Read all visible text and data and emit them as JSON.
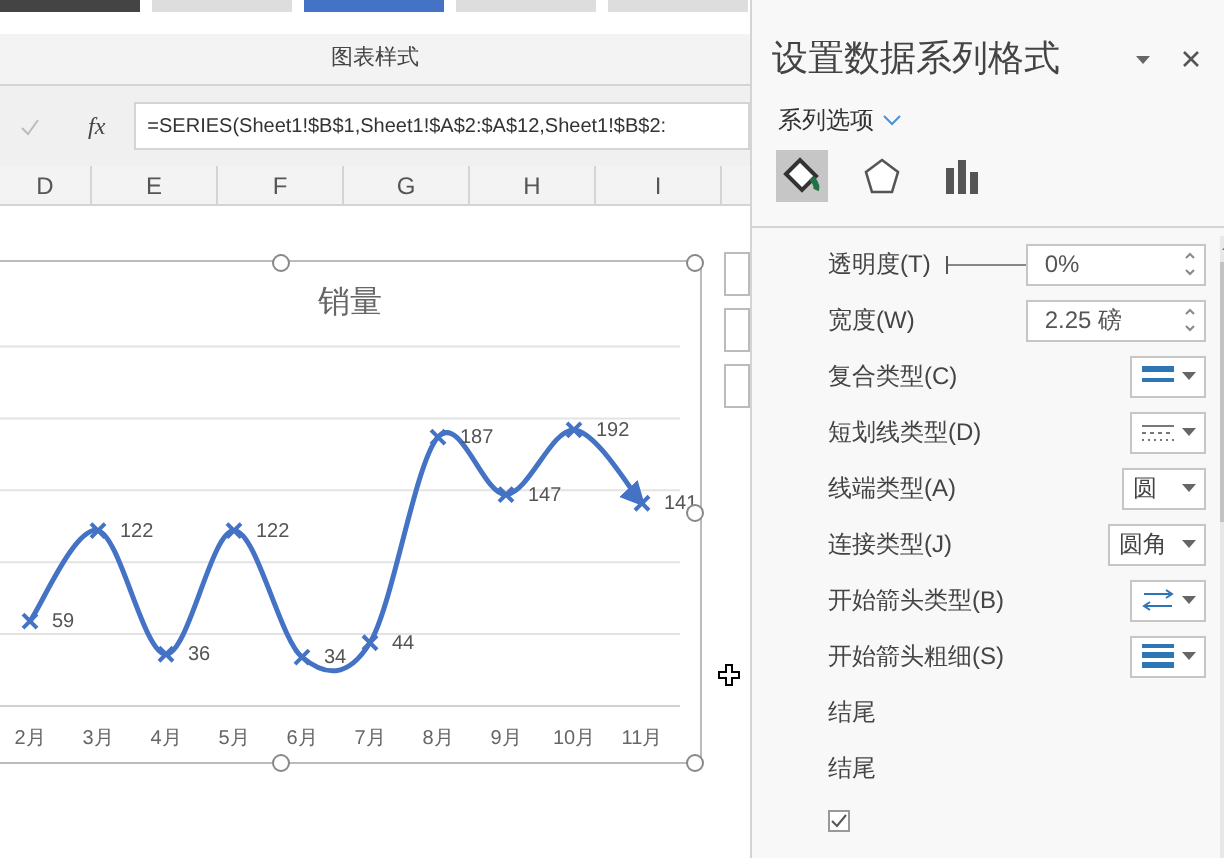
{
  "ribbon": {
    "group_label": "图表样式"
  },
  "formula_bar": {
    "function_label": "fx",
    "formula": "=SERIES(Sheet1!$B$1,Sheet1!$A$2:$A$12,Sheet1!$B$2:"
  },
  "columns": [
    "D",
    "E",
    "F",
    "G",
    "H",
    "I"
  ],
  "chart": {
    "title": "销量",
    "chart_data": {
      "type": "line",
      "categories": [
        "2月",
        "3月",
        "4月",
        "5月",
        "6月",
        "7月",
        "8月",
        "9月",
        "10月",
        "11月"
      ],
      "series": [
        {
          "color": "#4472c4",
          "marker": "x",
          "values": [
            59,
            122,
            36,
            122,
            34,
            44,
            187,
            147,
            192,
            141
          ]
        }
      ],
      "data_labels": true
    }
  },
  "panel": {
    "title": "设置数据系列格式",
    "section": "系列选项",
    "tabs": [
      {
        "kind": "fill",
        "selected": true
      },
      {
        "kind": "effects",
        "selected": false
      },
      {
        "kind": "series",
        "selected": false
      }
    ],
    "rows": [
      {
        "kind": "slider-spin",
        "label": "透明度(T)",
        "value": "0%",
        "level": 0
      },
      {
        "kind": "spin",
        "label": "宽度(W)",
        "value": "2.25 磅"
      },
      {
        "kind": "compound",
        "label": "复合类型(C)"
      },
      {
        "kind": "dash",
        "label": "短划线类型(D)"
      },
      {
        "kind": "select",
        "label": "线端类型(A)",
        "value": "圆"
      },
      {
        "kind": "select",
        "label": "连接类型(J)",
        "value": "圆角"
      },
      {
        "kind": "arrows",
        "label": "开始箭头类型(B)"
      },
      {
        "kind": "weights",
        "label": "开始箭头粗细(S)"
      },
      {
        "kind": "label",
        "label": "结尾"
      },
      {
        "kind": "label",
        "label": "结尾"
      },
      {
        "kind": "checkbox",
        "checked": true
      }
    ]
  }
}
